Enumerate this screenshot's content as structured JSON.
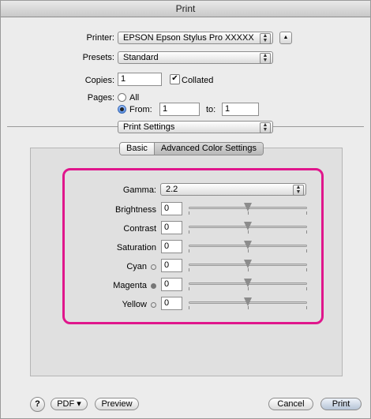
{
  "window": {
    "title": "Print"
  },
  "printer": {
    "label": "Printer:",
    "value": "EPSON Epson Stylus Pro XXXXX",
    "disclosure": "▲"
  },
  "presets": {
    "label": "Presets:",
    "value": "Standard"
  },
  "copies": {
    "label": "Copies:",
    "value": "1",
    "collated_label": "Collated",
    "collated_checked": true
  },
  "pages": {
    "label": "Pages:",
    "all_label": "All",
    "from_label": "From:",
    "from_value": "1",
    "to_label": "to:",
    "to_value": "1",
    "selected": "from"
  },
  "section": {
    "value": "Print Settings"
  },
  "tabs": [
    {
      "label": "Basic",
      "active": false
    },
    {
      "label": "Advanced Color Settings",
      "active": true
    }
  ],
  "gamma": {
    "label": "Gamma:",
    "value": "2.2"
  },
  "sliders": [
    {
      "label": "Brightness",
      "value": "0",
      "dot": "none"
    },
    {
      "label": "Contrast",
      "value": "0",
      "dot": "none"
    },
    {
      "label": "Saturation",
      "value": "0",
      "dot": "none"
    },
    {
      "label": "Cyan",
      "value": "0",
      "dot": "empty"
    },
    {
      "label": "Magenta",
      "value": "0",
      "dot": "filled"
    },
    {
      "label": "Yellow",
      "value": "0",
      "dot": "empty"
    }
  ],
  "footer": {
    "help": "?",
    "pdf": "PDF ▾",
    "preview": "Preview",
    "cancel": "Cancel",
    "print": "Print"
  },
  "colors": {
    "highlight": "#e0168c",
    "radio_selected": "#5b8fe0"
  },
  "icons": {
    "popup_arrows": "⇅",
    "disclosure": "triangle-up",
    "dot_cyan": "circle-outline",
    "dot_magenta": "circle-filled",
    "dot_yellow": "circle-outline"
  }
}
